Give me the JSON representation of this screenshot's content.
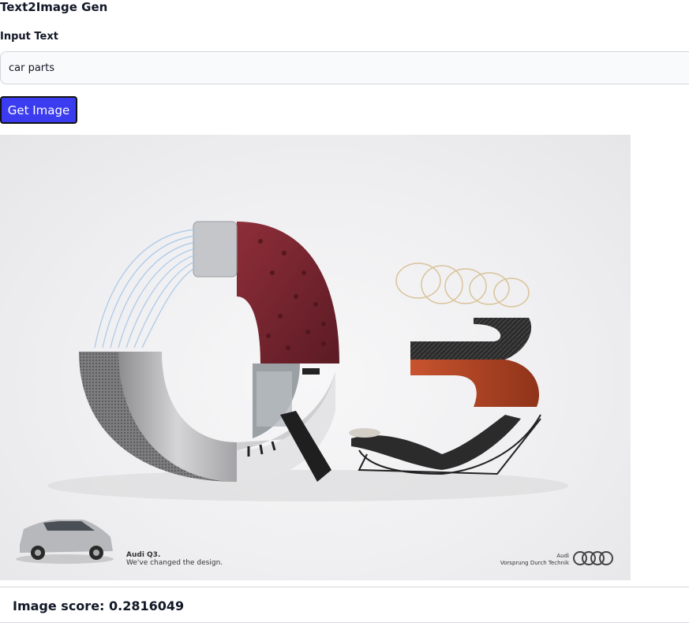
{
  "app": {
    "title": "Text2Image Gen"
  },
  "form": {
    "input_label": "Input Text",
    "input_value": "car parts",
    "button_label": "Get Image"
  },
  "result": {
    "ad_caption_title": "Audi Q3.",
    "ad_caption_sub": "We've changed the design.",
    "brand_name": "Audi",
    "brand_slogan": "Vorsprung Durch Technik",
    "score_text": "Image score: 0.2816049"
  },
  "colors": {
    "button_bg": "#3b3bf0",
    "leather": "#7a2730",
    "wood": "#b8452a",
    "carbon": "#2e2e2e",
    "metal": "#b9b9bb"
  }
}
